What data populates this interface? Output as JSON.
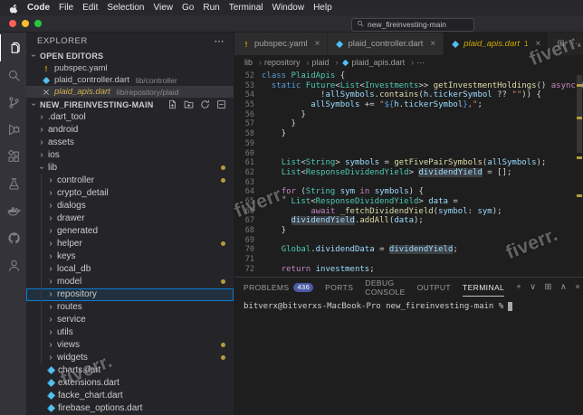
{
  "watermark": {
    "text": "fiverr."
  },
  "menu_bar": {
    "items": [
      "Code",
      "File",
      "Edit",
      "Selection",
      "View",
      "Go",
      "Run",
      "Terminal",
      "Window",
      "Help"
    ]
  },
  "title_bar": {
    "search_text": "new_fireinvesting-main"
  },
  "activity_bar": {
    "items": [
      {
        "name": "explorer-icon",
        "glyph": "files",
        "active": true
      },
      {
        "name": "search-icon",
        "glyph": "search",
        "active": false
      },
      {
        "name": "source-control-icon",
        "glyph": "scm",
        "active": false
      },
      {
        "name": "run-and-debug-icon",
        "glyph": "debug",
        "active": false
      },
      {
        "name": "extensions-icon",
        "glyph": "extensions",
        "active": false
      },
      {
        "name": "testing-icon",
        "glyph": "beaker",
        "active": false
      },
      {
        "name": "docker-icon",
        "glyph": "docker",
        "active": false
      },
      {
        "name": "github-icon",
        "glyph": "github",
        "active": false
      },
      {
        "name": "account-icon",
        "glyph": "account",
        "active": false
      }
    ]
  },
  "sidebar": {
    "title": "EXPLORER",
    "title_actions": [
      {
        "name": "explorer-more-actions-icon",
        "char": "⋯"
      }
    ],
    "open_editors": {
      "header": "OPEN EDITORS",
      "items": [
        {
          "label": "pubspec.yaml",
          "path": "",
          "icon": "warning",
          "active": false,
          "warn_name": false
        },
        {
          "label": "plaid_controller.dart",
          "path": "lib/controller",
          "icon": "dart",
          "active": false,
          "warn_name": false
        },
        {
          "label": "plaid_apis.dart",
          "path": "lib/repository/plaid",
          "icon": "close",
          "active": true,
          "warn_name": true
        }
      ]
    },
    "project": {
      "header": "NEW_FIREINVESTING-MAIN",
      "actions": [
        {
          "name": "new-file-icon",
          "glyph": "newfile"
        },
        {
          "name": "new-folder-icon",
          "glyph": "newfolder"
        },
        {
          "name": "refresh-explorer-icon",
          "glyph": "refresh"
        },
        {
          "name": "collapse-folders-icon",
          "glyph": "collapseall"
        }
      ],
      "tree": [
        {
          "label": ".dart_tool",
          "type": "folder",
          "level": 0,
          "expanded": false,
          "selected": false,
          "dot": false
        },
        {
          "label": "android",
          "type": "folder",
          "level": 0,
          "expanded": false,
          "selected": false,
          "dot": false
        },
        {
          "label": "assets",
          "type": "folder",
          "level": 0,
          "expanded": false,
          "selected": false,
          "dot": false
        },
        {
          "label": "ios",
          "type": "folder",
          "level": 0,
          "expanded": false,
          "selected": false,
          "dot": false
        },
        {
          "label": "lib",
          "type": "folder",
          "level": 0,
          "expanded": true,
          "selected": false,
          "dot": true
        },
        {
          "label": "controller",
          "type": "folder",
          "level": 1,
          "expanded": false,
          "selected": false,
          "dot": true
        },
        {
          "label": "crypto_detail",
          "type": "folder",
          "level": 1,
          "expanded": false,
          "selected": false,
          "dot": false
        },
        {
          "label": "dialogs",
          "type": "folder",
          "level": 1,
          "expanded": false,
          "selected": false,
          "dot": false
        },
        {
          "label": "drawer",
          "type": "folder",
          "level": 1,
          "expanded": false,
          "selected": false,
          "dot": false
        },
        {
          "label": "generated",
          "type": "folder",
          "level": 1,
          "expanded": false,
          "selected": false,
          "dot": false
        },
        {
          "label": "helper",
          "type": "folder",
          "level": 1,
          "expanded": false,
          "selected": false,
          "dot": true
        },
        {
          "label": "keys",
          "type": "folder",
          "level": 1,
          "expanded": false,
          "selected": false,
          "dot": false
        },
        {
          "label": "local_db",
          "type": "folder",
          "level": 1,
          "expanded": false,
          "selected": false,
          "dot": false
        },
        {
          "label": "model",
          "type": "folder",
          "level": 1,
          "expanded": false,
          "selected": false,
          "dot": true
        },
        {
          "label": "repository",
          "type": "folder",
          "level": 1,
          "expanded": false,
          "selected": true,
          "dot": false
        },
        {
          "label": "routes",
          "type": "folder",
          "level": 1,
          "expanded": false,
          "selected": false,
          "dot": false
        },
        {
          "label": "service",
          "type": "folder",
          "level": 1,
          "expanded": false,
          "selected": false,
          "dot": false
        },
        {
          "label": "utils",
          "type": "folder",
          "level": 1,
          "expanded": false,
          "selected": false,
          "dot": false
        },
        {
          "label": "views",
          "type": "folder",
          "level": 1,
          "expanded": false,
          "selected": false,
          "dot": true
        },
        {
          "label": "widgets",
          "type": "folder",
          "level": 1,
          "expanded": false,
          "selected": false,
          "dot": true
        },
        {
          "label": "charts.dart",
          "type": "file",
          "level": 0,
          "expanded": false,
          "selected": false,
          "dot": false
        },
        {
          "label": "extensions.dart",
          "type": "file",
          "level": 0,
          "expanded": false,
          "selected": false,
          "dot": false
        },
        {
          "label": "facke_chart.dart",
          "type": "file",
          "level": 0,
          "expanded": false,
          "selected": false,
          "dot": false
        },
        {
          "label": "firebase_options.dart",
          "type": "file",
          "level": 0,
          "expanded": false,
          "selected": false,
          "dot": false
        }
      ]
    }
  },
  "editor": {
    "tabs": [
      {
        "label": "pubspec.yaml",
        "icon": "warning",
        "active": false,
        "badge": "",
        "italic": false
      },
      {
        "label": "plaid_controller.dart",
        "icon": "dart",
        "active": false,
        "badge": "",
        "italic": false
      },
      {
        "label": "plaid_apis.dart",
        "icon": "dart",
        "active": true,
        "badge": "1",
        "italic": true
      }
    ],
    "tab_actions": [
      {
        "name": "split-editor-icon",
        "char": "⊞"
      },
      {
        "name": "more-editor-actions-icon",
        "char": "⋯"
      }
    ],
    "breadcrumb": [
      {
        "label": "lib"
      },
      {
        "label": "repository"
      },
      {
        "label": "plaid"
      },
      {
        "label": "plaid_apis.dart",
        "icon": "dart"
      },
      {
        "label": "⋯"
      }
    ],
    "code": {
      "lines": [
        {
          "n": "52",
          "t": [
            [
              "k",
              "class"
            ],
            [
              "p",
              " "
            ],
            [
              "y",
              "PlaidApis"
            ],
            [
              "p",
              " {"
            ]
          ]
        },
        {
          "n": "53",
          "t": [
            [
              "p",
              "  "
            ],
            [
              "k",
              "static"
            ],
            [
              "p",
              " "
            ],
            [
              "y",
              "Future"
            ],
            [
              "p",
              "<"
            ],
            [
              "y",
              "List"
            ],
            [
              "p",
              "<"
            ],
            [
              "y",
              "Investments"
            ],
            [
              "p",
              ">> "
            ],
            [
              "f",
              "getInvestmentHoldings"
            ],
            [
              "p",
              "() "
            ],
            [
              "c",
              "async"
            ],
            [
              "p",
              " {"
            ]
          ]
        },
        {
          "n": "54",
          "t": [
            [
              "p",
              "            !"
            ],
            [
              "v",
              "allSymbols"
            ],
            [
              "p",
              "."
            ],
            [
              "f",
              "contains"
            ],
            [
              "p",
              "("
            ],
            [
              "v",
              "h"
            ],
            [
              "p",
              "."
            ],
            [
              "v",
              "tickerSymbol"
            ],
            [
              "p",
              " ?? "
            ],
            [
              "s",
              "\"\""
            ],
            [
              "p",
              ")) {"
            ]
          ]
        },
        {
          "n": "55",
          "t": [
            [
              "p",
              "          "
            ],
            [
              "v",
              "allSymbols"
            ],
            [
              "p",
              " += "
            ],
            [
              "s",
              "\""
            ],
            [
              "i",
              "${"
            ],
            [
              "v",
              "h"
            ],
            [
              "p",
              "."
            ],
            [
              "v",
              "tickerSymbol"
            ],
            [
              "i",
              "}"
            ],
            [
              "s",
              ",\""
            ],
            [
              "p",
              ";"
            ]
          ]
        },
        {
          "n": "56",
          "t": [
            [
              "p",
              "        }"
            ]
          ]
        },
        {
          "n": "57",
          "t": [
            [
              "p",
              "      }"
            ]
          ]
        },
        {
          "n": "58",
          "t": [
            [
              "p",
              "    }"
            ]
          ]
        },
        {
          "n": "59",
          "t": []
        },
        {
          "n": "60",
          "t": []
        },
        {
          "n": "61",
          "t": [
            [
              "p",
              "    "
            ],
            [
              "y",
              "List"
            ],
            [
              "p",
              "<"
            ],
            [
              "y",
              "String"
            ],
            [
              "p",
              "> "
            ],
            [
              "v",
              "symbols"
            ],
            [
              "p",
              " = "
            ],
            [
              "f",
              "getFivePairSymbols"
            ],
            [
              "p",
              "("
            ],
            [
              "v",
              "allSymbols"
            ],
            [
              "p",
              ");"
            ]
          ]
        },
        {
          "n": "62",
          "t": [
            [
              "p",
              "    "
            ],
            [
              "y",
              "List"
            ],
            [
              "p",
              "<"
            ],
            [
              "y",
              "ResponseDividendYield"
            ],
            [
              "p",
              "> "
            ],
            [
              "vh",
              "dividendYield"
            ],
            [
              "p",
              " = [];"
            ]
          ]
        },
        {
          "n": "63",
          "t": []
        },
        {
          "n": "64",
          "t": [
            [
              "p",
              "    "
            ],
            [
              "c",
              "for"
            ],
            [
              "p",
              " ("
            ],
            [
              "y",
              "String"
            ],
            [
              "p",
              " "
            ],
            [
              "v",
              "sym"
            ],
            [
              "p",
              " "
            ],
            [
              "c",
              "in"
            ],
            [
              "p",
              " "
            ],
            [
              "v",
              "symbols"
            ],
            [
              "p",
              ") {"
            ]
          ]
        },
        {
          "n": "65",
          "t": [
            [
              "p",
              "      "
            ],
            [
              "y",
              "List"
            ],
            [
              "p",
              "<"
            ],
            [
              "y",
              "ResponseDividendYield"
            ],
            [
              "p",
              "> "
            ],
            [
              "v",
              "data"
            ],
            [
              "p",
              " ="
            ]
          ]
        },
        {
          "n": "66",
          "t": [
            [
              "p",
              "          "
            ],
            [
              "c",
              "await"
            ],
            [
              "p",
              " "
            ],
            [
              "f",
              "_fetchDividendYield"
            ],
            [
              "p",
              "("
            ],
            [
              "v",
              "symbol"
            ],
            [
              "p",
              ": "
            ],
            [
              "v",
              "sym"
            ],
            [
              "p",
              ");"
            ]
          ]
        },
        {
          "n": "67",
          "t": [
            [
              "p",
              "      "
            ],
            [
              "vh",
              "dividendYield"
            ],
            [
              "p",
              "."
            ],
            [
              "f",
              "addAll"
            ],
            [
              "p",
              "("
            ],
            [
              "v",
              "data"
            ],
            [
              "p",
              ");"
            ]
          ]
        },
        {
          "n": "68",
          "t": [
            [
              "p",
              "    }"
            ]
          ]
        },
        {
          "n": "69",
          "t": []
        },
        {
          "n": "70",
          "t": [
            [
              "p",
              "    "
            ],
            [
              "y",
              "Global"
            ],
            [
              "p",
              "."
            ],
            [
              "v",
              "dividendData"
            ],
            [
              "p",
              " = "
            ],
            [
              "vh",
              "dividendYield"
            ],
            [
              "p",
              ";"
            ]
          ]
        },
        {
          "n": "71",
          "t": []
        },
        {
          "n": "72",
          "t": [
            [
              "p",
              "    "
            ],
            [
              "c",
              "return"
            ],
            [
              "p",
              " "
            ],
            [
              "v",
              "investments"
            ],
            [
              "p",
              ";"
            ]
          ]
        }
      ]
    }
  },
  "panel": {
    "tabs": [
      {
        "label": "PROBLEMS",
        "badge": "436",
        "active": false
      },
      {
        "label": "PORTS",
        "badge": "",
        "active": false
      },
      {
        "label": "DEBUG CONSOLE",
        "badge": "",
        "active": false
      },
      {
        "label": "OUTPUT",
        "badge": "",
        "active": false
      },
      {
        "label": "TERMINAL",
        "badge": "",
        "active": true
      }
    ],
    "actions": [
      {
        "name": "new-terminal-icon",
        "char": "+"
      },
      {
        "name": "terminal-dropdown-icon",
        "char": "∨"
      },
      {
        "name": "split-terminal-icon",
        "char": "⊞"
      },
      {
        "name": "maximize-panel-icon",
        "char": "∧"
      },
      {
        "name": "close-panel-icon",
        "char": "×"
      }
    ],
    "terminal": {
      "prompt": "bitverx@bitverxs-MacBook-Pro new_fireinvesting-main %"
    }
  }
}
